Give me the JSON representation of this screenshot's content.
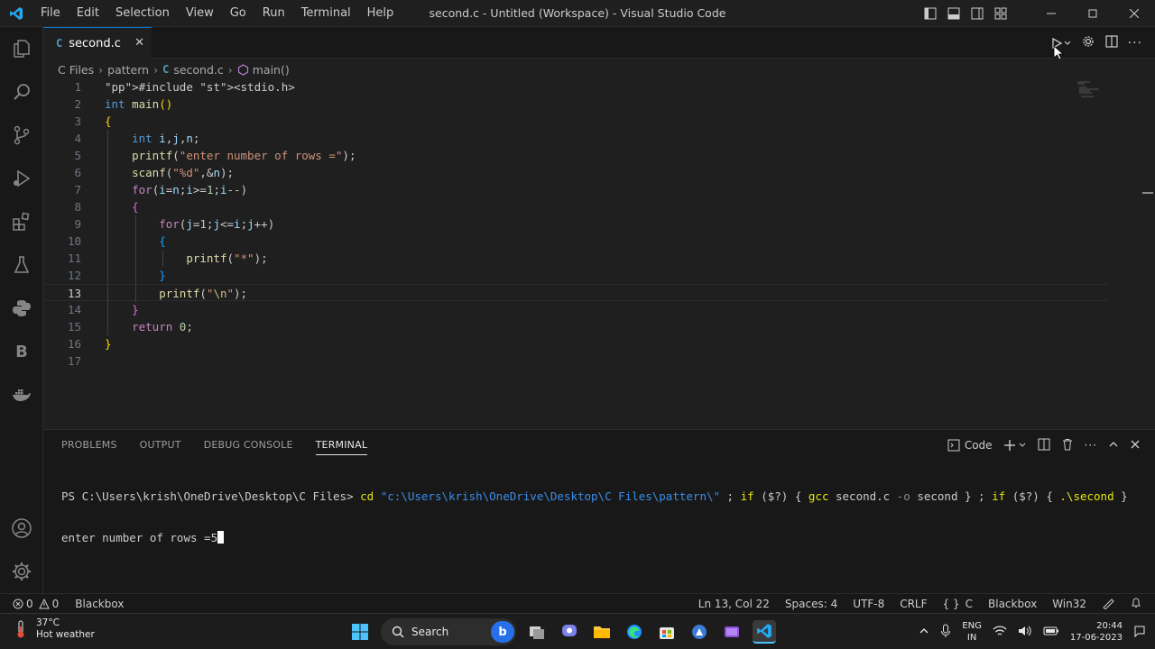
{
  "titlebar": {
    "menu": [
      "File",
      "Edit",
      "Selection",
      "View",
      "Go",
      "Run",
      "Terminal",
      "Help"
    ],
    "title": "second.c - Untitled (Workspace) - Visual Studio Code"
  },
  "tab": {
    "icon_letter": "C",
    "filename": "second.c"
  },
  "breadcrumb": {
    "folder1": "C Files",
    "folder2": "pattern",
    "file_icon": "C",
    "file": "second.c",
    "symbol": "main()"
  },
  "editor": {
    "current_line": 13,
    "line_numbers": [
      "1",
      "2",
      "3",
      "4",
      "5",
      "6",
      "7",
      "8",
      "9",
      "10",
      "11",
      "12",
      "13",
      "14",
      "15",
      "16",
      "17"
    ],
    "lines": [
      "#include <stdio.h>",
      "int main()",
      "{",
      "    int i,j,n;",
      "    printf(\"enter number of rows =\");",
      "    scanf(\"%d\",&n);",
      "    for(i=n;i>=1;i--)",
      "    {",
      "        for(j=1;j<=i;j++)",
      "        {",
      "            printf(\"*\");",
      "        }",
      "        printf(\"\\n\");",
      "    }",
      "    return 0;",
      "}",
      ""
    ]
  },
  "panel": {
    "tabs": [
      "PROBLEMS",
      "OUTPUT",
      "DEBUG CONSOLE",
      "TERMINAL"
    ],
    "active_tab": "TERMINAL",
    "terminal_profile": "Code",
    "terminal": {
      "prompt": "PS C:\\Users\\krish\\OneDrive\\Desktop\\C Files>",
      "cmd_cd": "cd",
      "cd_path": "\"c:\\Users\\krish\\OneDrive\\Desktop\\C Files\\pattern\\\"",
      "rest1": " ; ",
      "if1": "if",
      "cond1": " ($?) { ",
      "gcc": "gcc",
      "gcc_args": " second.c ",
      "flag": "-o",
      "gcc_out": " second } ; ",
      "if2": "if",
      "cond2": " ($?) { ",
      "run": ".\\second",
      "end": " }",
      "output_line": "enter number of rows =5"
    }
  },
  "statusbar": {
    "errors": "0",
    "warnings": "0",
    "left_ext": "Blackbox",
    "position": "Ln 13, Col 22",
    "spaces": "Spaces: 4",
    "encoding": "UTF-8",
    "eol": "CRLF",
    "language": "C",
    "right_ext": "Blackbox",
    "platform": "Win32"
  },
  "taskbar": {
    "temperature": "37°C",
    "weather": "Hot weather",
    "search_label": "Search",
    "lang_top": "ENG",
    "lang_bottom": "IN",
    "time": "20:44",
    "date": "17-06-2023"
  },
  "colors": {
    "accent": "#0078d4",
    "editor_bg": "#1f1f1f",
    "sidebar_bg": "#181818"
  }
}
